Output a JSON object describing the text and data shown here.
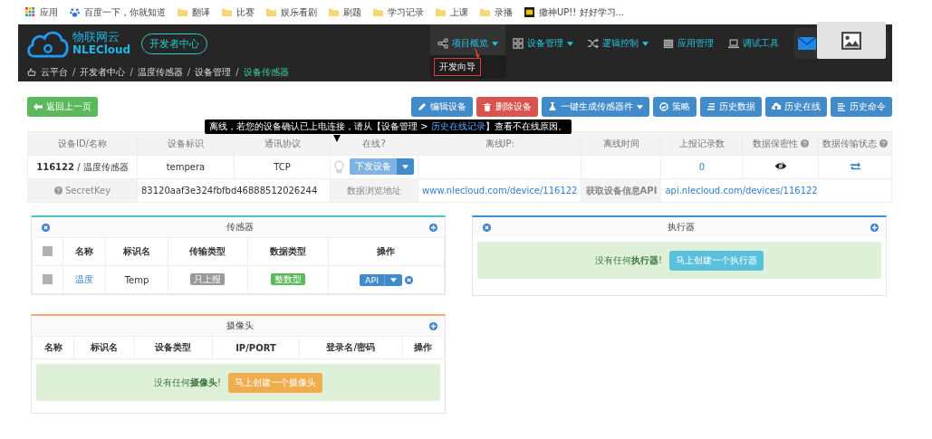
{
  "bookmarks": [
    {
      "label": "应用",
      "kind": "apps"
    },
    {
      "label": "百度一下，你就知道",
      "kind": "paw"
    },
    {
      "label": "翻译",
      "kind": "folder"
    },
    {
      "label": "比赛",
      "kind": "folder"
    },
    {
      "label": "娱乐看剧",
      "kind": "folder"
    },
    {
      "label": "刷题",
      "kind": "folder"
    },
    {
      "label": "学习记录",
      "kind": "folder"
    },
    {
      "label": "上课",
      "kind": "folder"
    },
    {
      "label": "录播",
      "kind": "folder"
    },
    {
      "label": "撒神UP!! 好好学习...",
      "kind": "site"
    }
  ],
  "header": {
    "brand_cn": "物联网云",
    "brand_en": "NLECloud",
    "dev_center": "开发者中心",
    "nav": [
      {
        "label": "项目概览",
        "kind": "share",
        "caret": true,
        "expanded": true
      },
      {
        "label": "设备管理",
        "kind": "grid",
        "caret": true,
        "expanded": false
      },
      {
        "label": "逻辑控制",
        "kind": "shuffle",
        "caret": true,
        "expanded": false
      },
      {
        "label": "应用管理",
        "kind": "server",
        "caret": false,
        "expanded": false
      },
      {
        "label": "调试工具",
        "kind": "laptop",
        "caret": false,
        "expanded": false
      }
    ],
    "dropdown_item": "开发向导"
  },
  "breadcrumb": {
    "separator": "/",
    "items": [
      {
        "label": "云平台",
        "selected": false
      },
      {
        "label": "开发者中心",
        "selected": false
      },
      {
        "label": "温度传感器",
        "selected": false
      },
      {
        "label": "设备管理",
        "selected": false
      },
      {
        "label": "设备传感器",
        "selected": true
      }
    ]
  },
  "back_button": "返回上一页",
  "actions": [
    {
      "label": "编辑设备",
      "kind": "edit",
      "caret": false
    },
    {
      "label": "删除设备",
      "kind": "delete",
      "caret": false
    },
    {
      "label": "一键生成传感器件",
      "kind": "generate",
      "caret": true
    },
    {
      "label": "策略",
      "kind": "strategy",
      "caret": false
    },
    {
      "label": "历史数据",
      "kind": "data",
      "caret": false
    },
    {
      "label": "历史在线",
      "kind": "online",
      "caret": false
    },
    {
      "label": "历史命令",
      "kind": "command",
      "caret": false
    }
  ],
  "tooltip": {
    "before": "离线，若您的设备确认已上电连接，请从【设备管理 > ",
    "link": "历史在线记录",
    "after": "】查看不在线原因。"
  },
  "device": {
    "columns": [
      {
        "label": "设备ID/名称",
        "help": false
      },
      {
        "label": "设备标识",
        "help": false
      },
      {
        "label": "通讯协议",
        "help": false
      },
      {
        "label": "在线?",
        "help": false
      },
      {
        "label": "离线IP:",
        "help": false
      },
      {
        "label": "离线时间",
        "help": false
      },
      {
        "label": "上报记录数",
        "help": false
      },
      {
        "label": "数据保密性",
        "help": true
      },
      {
        "label": "数据传输状态",
        "help": true
      }
    ],
    "id_name": "**116122** / 温度传感器",
    "identifier": "tempera",
    "protocol": "TCP",
    "online": false,
    "send_button": "下发设备",
    "record_count": "0",
    "secret_label": "SecretKey",
    "secret": "83120aaf3e324fbfbd46888512026244",
    "browse_label": "数据浏览地址",
    "browse_url": "www.nlecloud.com/device/116122",
    "api_label": "获取设备信息API",
    "api_url": "api.nlecloud.com/devices/116122"
  },
  "sensors": {
    "title": "传感器",
    "header_checked": false,
    "columns": [
      "名称",
      "标识名",
      "传输类型",
      "数据类型",
      "操作"
    ],
    "rows": [
      {
        "checked": false,
        "name": "温度",
        "tag": "Temp",
        "transfer": "只上报",
        "data_type": "整数型",
        "api": "API"
      }
    ]
  },
  "actuators": {
    "title": "执行器",
    "empty": "没有任何**执行器**!",
    "create": "马上创建一个执行器"
  },
  "cameras": {
    "title": "摄像头",
    "columns": [
      "名称",
      "标识名",
      "设备类型",
      "IP/PORT",
      "登录名/密码",
      "操作"
    ],
    "empty": "没有任何**摄像头**!",
    "create": "马上创建一个摄像头"
  }
}
